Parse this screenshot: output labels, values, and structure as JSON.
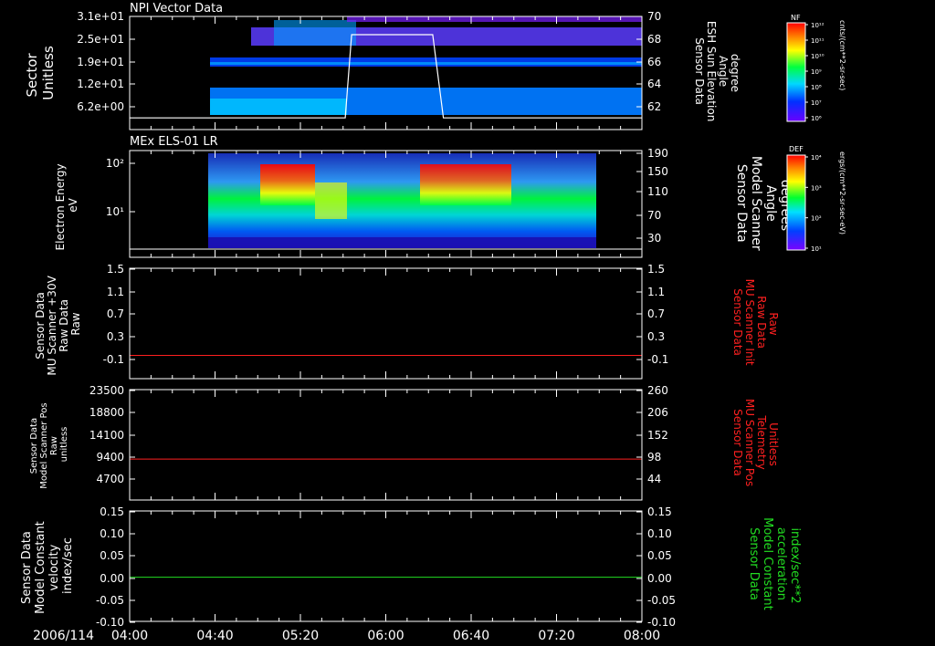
{
  "chart_data": [
    {
      "type": "heatmap",
      "title": "NPI Vector Data",
      "ylabel_left": [
        "Sector",
        "Unitless"
      ],
      "y_ticks_left": [
        "3.1e+01",
        "2.5e+01",
        "1.9e+01",
        "1.2e+01",
        "6.2e+00"
      ],
      "ylabel_right": [
        "Sensor Data",
        "ESH Sun Elevation",
        "Angle",
        "degree"
      ],
      "y_ticks_right": [
        "70",
        "68",
        "66",
        "64",
        "62"
      ],
      "ylim_right": [
        60.5,
        70
      ],
      "colorbar": {
        "label": "NF",
        "units": "cnts/(cm**2-sr-sec)",
        "ticks": [
          "10¹²",
          "10¹¹",
          "10¹⁰",
          "10⁹",
          "10⁸",
          "10⁷",
          "10⁶"
        ]
      },
      "data_start": "04:40",
      "line": {
        "name": "ESH Sun Elevation Angle",
        "color": "#ffffff",
        "x": [
          "04:00",
          "05:41",
          "05:44",
          "06:22",
          "06:27",
          "08:00"
        ],
        "y": [
          61.0,
          61.0,
          68.8,
          68.8,
          61.0,
          61.0
        ]
      }
    },
    {
      "type": "heatmap",
      "title": "MEx ELS-01 LR",
      "ylabel_left": [
        "Electron Energy",
        "eV"
      ],
      "y_ticks_left": [
        "10²",
        "10¹"
      ],
      "ylabel_right": [
        "Sensor Data",
        "Model Scanner",
        "Angle",
        "degrees"
      ],
      "y_ticks_right": [
        "190",
        "150",
        "110",
        "70",
        "30"
      ],
      "colorbar": {
        "label": "DEF",
        "units": "ergs/(cm**2-sr-sec-eV)",
        "ticks": [
          "10⁴",
          "10³",
          "10²",
          "10¹"
        ]
      },
      "data_range": [
        "04:40",
        "07:35"
      ],
      "high_flux_intervals": [
        [
          "05:00",
          "05:18"
        ],
        [
          "06:05",
          "06:58"
        ]
      ],
      "line": {
        "name": "Model Scanner Angle",
        "color": "#ffffff",
        "y": 12
      }
    },
    {
      "type": "line",
      "ylabel_left": [
        "Sensor Data",
        "MU Scanner +30V",
        "Raw Data",
        "Raw"
      ],
      "y_ticks_left": [
        "1.5",
        "1.1",
        "0.7",
        "0.3",
        "-0.1"
      ],
      "ylabel_right": [
        "Sensor Data",
        "MU Scanner Init",
        "Raw Data",
        "Raw"
      ],
      "y_ticks_right": [
        "1.5",
        "1.1",
        "0.7",
        "0.3",
        "-0.1"
      ],
      "ylim": [
        -0.4,
        1.5
      ],
      "series": [
        {
          "name": "MU Scanner Init",
          "color": "#ff2020",
          "value": 0.0
        }
      ]
    },
    {
      "type": "line",
      "ylabel_left": [
        "Sensor Data",
        "Model Scanner Pos",
        "Raw",
        "unitless"
      ],
      "y_ticks_left": [
        "23500",
        "18800",
        "14100",
        "9400",
        "4700"
      ],
      "ylabel_right": [
        "Sensor Data",
        "MU Scanner Pos",
        "Telemetry",
        "Unitless"
      ],
      "y_ticks_right": [
        "260",
        "206",
        "152",
        "98",
        "44"
      ],
      "ylim_right": [
        -10,
        260
      ],
      "series": [
        {
          "name": "MU Scanner Pos",
          "color": "#ff2020",
          "value": 90
        }
      ]
    },
    {
      "type": "line",
      "ylabel_left": [
        "Sensor Data",
        "Model Constant",
        "velocity",
        "index/sec"
      ],
      "y_ticks_left": [
        "0.15",
        "0.10",
        "0.05",
        "0.00",
        "-0.05",
        "-0.10"
      ],
      "ylabel_right": [
        "Sensor Data",
        "Model Constant",
        "acceleration",
        "index/sec**2"
      ],
      "y_ticks_right": [
        "0.15",
        "0.10",
        "0.05",
        "0.00",
        "-0.05",
        "-0.10"
      ],
      "ylim": [
        -0.1,
        0.15
      ],
      "series": [
        {
          "name": "Model Constant acceleration",
          "color": "#22dd22",
          "value": 0.0
        }
      ]
    }
  ],
  "x_axis": {
    "date": "2006/114",
    "tick_labels": [
      "04:00",
      "04:40",
      "05:20",
      "06:00",
      "06:40",
      "07:20",
      "08:00"
    ],
    "range": [
      "04:00",
      "08:00"
    ]
  }
}
